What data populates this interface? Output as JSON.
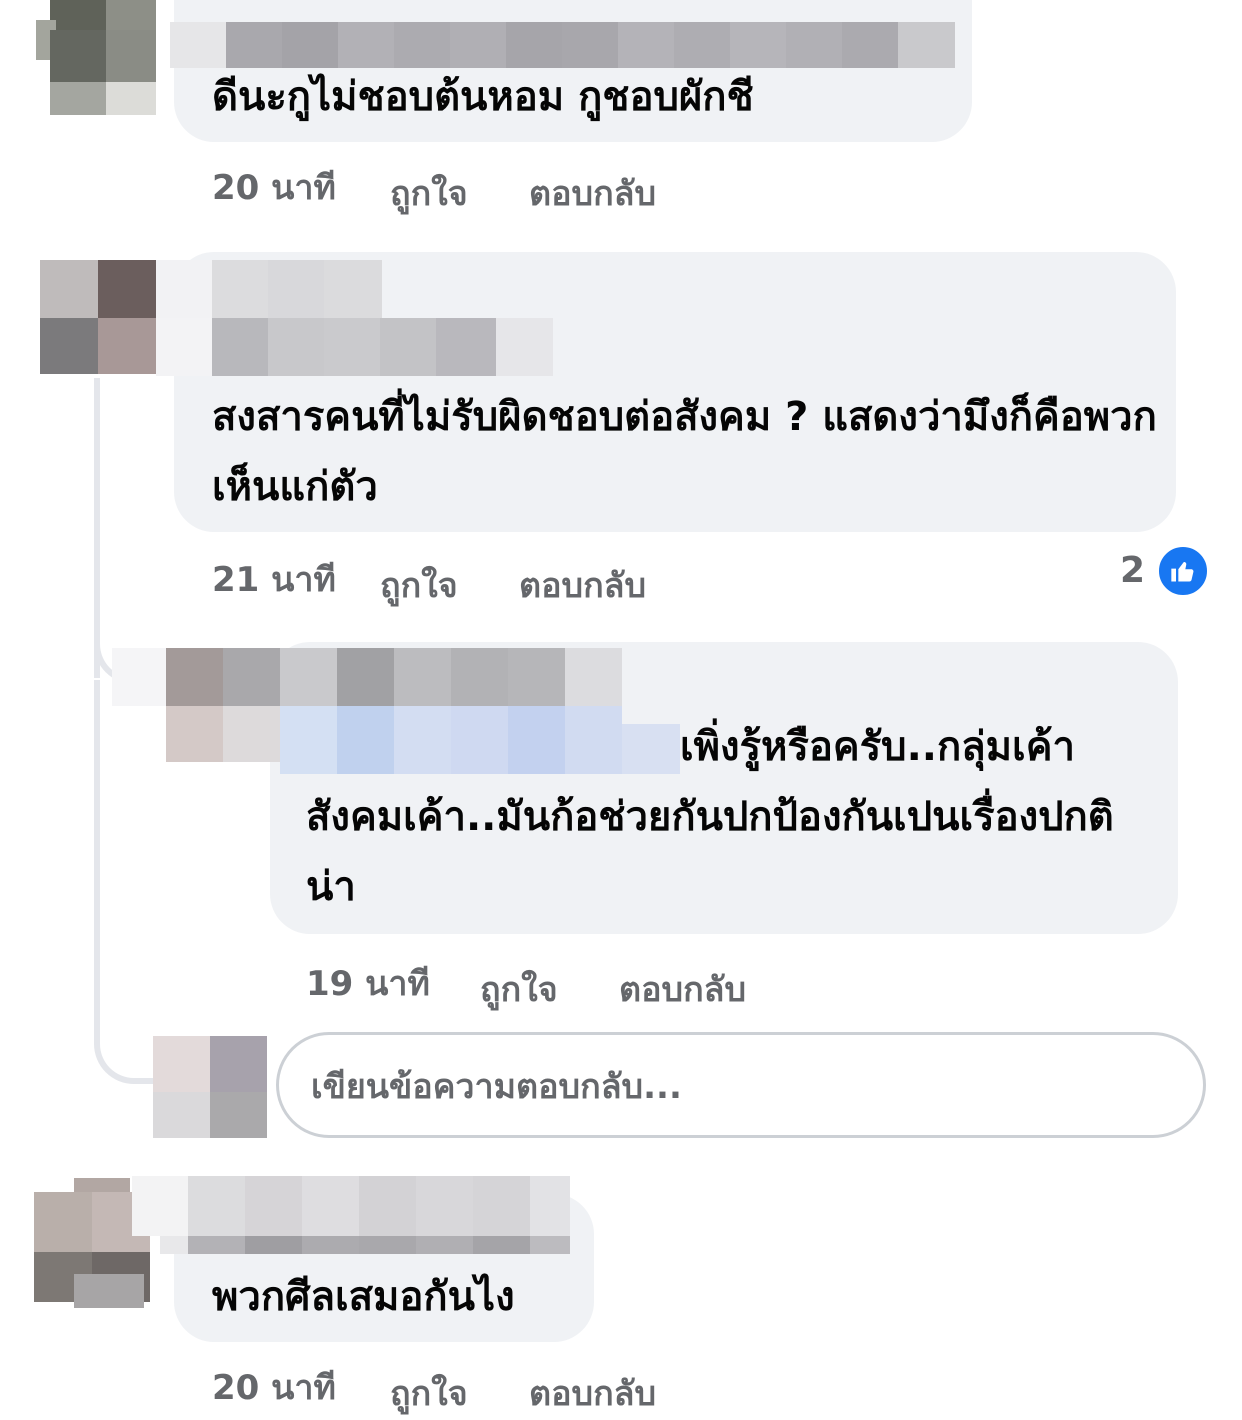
{
  "comments": [
    {
      "text": "ดีนะกูไม่ชอบต้นหอม กูชอบผักชี",
      "time": "20 นาที",
      "like": "ถูกใจ",
      "reply": "ตอบกลับ"
    },
    {
      "text": "สงสารคนที่ไม่รับผิดชอบต่อสังคม ? แสดงว่ามึงก็คือพวกเห็นแก่ตัว",
      "time": "21 นาที",
      "like": "ถูกใจ",
      "reply": "ตอบกลับ",
      "reaction_count": "2",
      "reaction_icon": "thumbs-up-icon",
      "reaction_color": "#1877f2"
    },
    {
      "text": "เพิ่งรู้หรือครับ..กลุ่มเค้าสังคมเค้า..มันก้อช่วยกันปกป้องกันเปนเรื่องปกติน่า",
      "time": "19 นาที",
      "like": "ถูกใจ",
      "reply": "ตอบกลับ"
    },
    {
      "text": "พวกศีลเสมอกันไง",
      "time": "20 นาที",
      "like": "ถูกใจ",
      "reply": "ตอบกลับ"
    }
  ],
  "reply_box": {
    "placeholder": "เขียนข้อความตอบกลับ..."
  }
}
